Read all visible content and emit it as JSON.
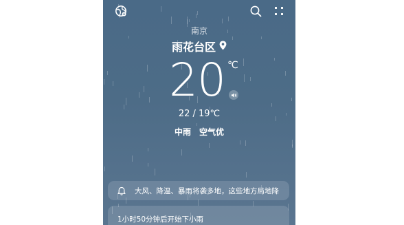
{
  "location": {
    "city": "南京",
    "district": "雨花台区"
  },
  "current": {
    "temperature": "20",
    "unit": "℃",
    "range": "22 / 19℃",
    "condition": "中雨",
    "air_quality": "空气优"
  },
  "alert": {
    "text": "大风、降温、暴雨将袭多地，这些地方局地降"
  },
  "precipitation": {
    "text": "1小时50分钟后开始下小雨"
  },
  "icons": {
    "globe": "globe-icon",
    "search": "search-icon",
    "more": "more-icon",
    "location_pin": "location-pin-icon",
    "speaker": "speaker-icon",
    "bell": "bell-icon"
  },
  "colors": {
    "background_top": "#4a6a87",
    "background_bottom": "#5a7590",
    "card": "rgba(255,255,255,0.14)"
  }
}
